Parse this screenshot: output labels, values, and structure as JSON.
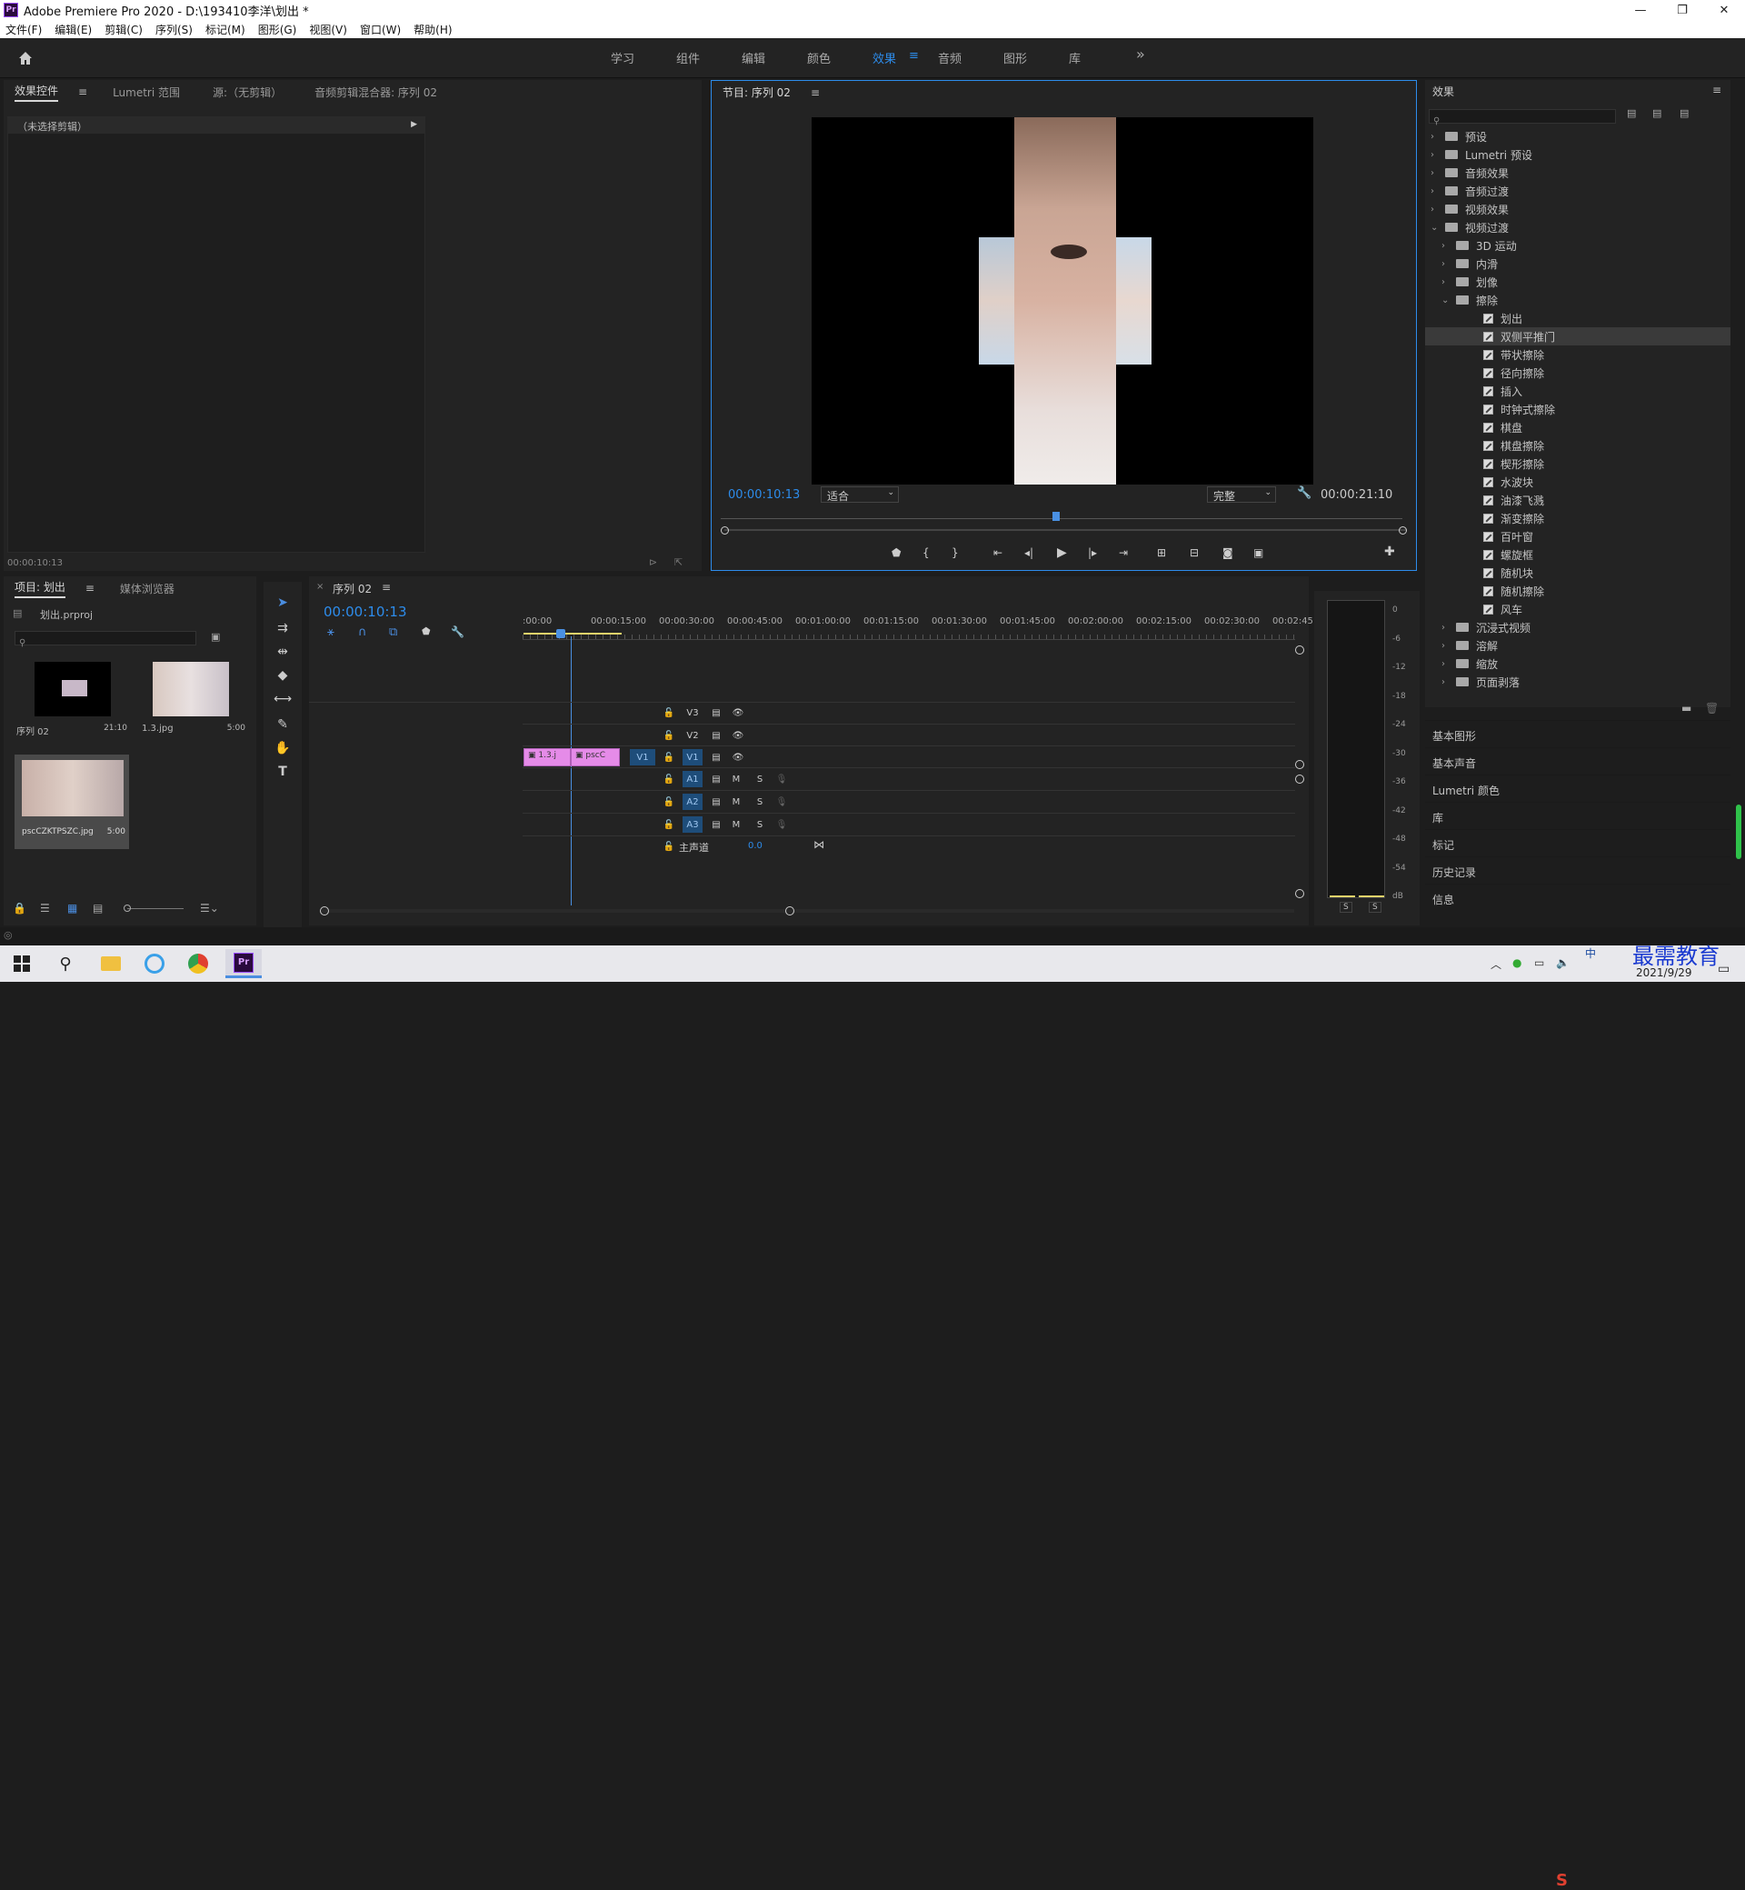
{
  "app": {
    "title": "Adobe Premiere Pro 2020 - D:\\193410李洋\\划出 *",
    "logo": "Pr"
  },
  "window_controls": {
    "minimize": "—",
    "maximize": "❐",
    "close": "✕"
  },
  "menu": [
    "文件(F)",
    "编辑(E)",
    "剪辑(C)",
    "序列(S)",
    "标记(M)",
    "图形(G)",
    "视图(V)",
    "窗口(W)",
    "帮助(H)"
  ],
  "workspaces": [
    {
      "label": "学习",
      "active": false
    },
    {
      "label": "组件",
      "active": false
    },
    {
      "label": "编辑",
      "active": false
    },
    {
      "label": "颜色",
      "active": false
    },
    {
      "label": "效果",
      "active": true
    },
    {
      "label": "音频",
      "active": false
    },
    {
      "label": "图形",
      "active": false
    },
    {
      "label": "库",
      "active": false
    }
  ],
  "workspace_more": "»",
  "source_panel": {
    "tabs": [
      "效果控件",
      "Lumetri 范围",
      "源:（无剪辑）",
      "音频剪辑混合器: 序列 02"
    ],
    "no_clip": "（未选择剪辑）",
    "timecode": "00:00:10:13"
  },
  "program": {
    "tab": "节目: 序列 02",
    "timecode": "00:00:10:13",
    "fit": "适合",
    "quality": "完整",
    "duration": "00:00:21:10"
  },
  "project": {
    "tabs": [
      "项目: 划出",
      "媒体浏览器"
    ],
    "file": "划出.prproj",
    "items": [
      {
        "name": "序列 02",
        "duration": "21:10"
      },
      {
        "name": "1.3.jpg",
        "duration": "5:00"
      },
      {
        "name": "pscCZKTPSZC.jpg",
        "duration": "5:00"
      }
    ]
  },
  "timeline": {
    "tab": "序列 02",
    "timecode": "00:00:10:13",
    "ruler": [
      ":00:00",
      "00:00:15:00",
      "00:00:30:00",
      "00:00:45:00",
      "00:01:00:00",
      "00:01:15:00",
      "00:01:30:00",
      "00:01:45:00",
      "00:02:00:00",
      "00:02:15:00",
      "00:02:30:00",
      "00:02:45:"
    ],
    "tracks": {
      "video": [
        "V3",
        "V2",
        "V1"
      ],
      "audio": [
        "A1",
        "A2",
        "A3"
      ],
      "master_label": "主声道",
      "master_value": "0.0",
      "src_patch": "V1",
      "toggles": {
        "m": "M",
        "s": "S"
      }
    },
    "clips": [
      {
        "label": "1.3.j"
      },
      {
        "label": "pscC"
      }
    ]
  },
  "audio_meter": {
    "scale": [
      "0",
      "-6",
      "-12",
      "-18",
      "-24",
      "-30",
      "-36",
      "-42",
      "-48",
      "-54",
      "dB"
    ],
    "solo": [
      "S",
      "S"
    ]
  },
  "effects": {
    "title": "效果",
    "tree": [
      {
        "label": "预设",
        "level": 0,
        "type": "folder",
        "open": false
      },
      {
        "label": "Lumetri 预设",
        "level": 0,
        "type": "folder",
        "open": false
      },
      {
        "label": "音频效果",
        "level": 0,
        "type": "folder",
        "open": false
      },
      {
        "label": "音频过渡",
        "level": 0,
        "type": "folder",
        "open": false
      },
      {
        "label": "视频效果",
        "level": 0,
        "type": "folder",
        "open": false
      },
      {
        "label": "视频过渡",
        "level": 0,
        "type": "folder",
        "open": true
      },
      {
        "label": "3D 运动",
        "level": 1,
        "type": "folder",
        "open": false
      },
      {
        "label": "内滑",
        "level": 1,
        "type": "folder",
        "open": false
      },
      {
        "label": "划像",
        "level": 1,
        "type": "folder",
        "open": false
      },
      {
        "label": "擦除",
        "level": 1,
        "type": "folder",
        "open": true
      },
      {
        "label": "划出",
        "level": 2,
        "type": "fx"
      },
      {
        "label": "双侧平推门",
        "level": 2,
        "type": "fx",
        "selected": true
      },
      {
        "label": "带状擦除",
        "level": 2,
        "type": "fx"
      },
      {
        "label": "径向擦除",
        "level": 2,
        "type": "fx"
      },
      {
        "label": "插入",
        "level": 2,
        "type": "fx"
      },
      {
        "label": "时钟式擦除",
        "level": 2,
        "type": "fx"
      },
      {
        "label": "棋盘",
        "level": 2,
        "type": "fx"
      },
      {
        "label": "棋盘擦除",
        "level": 2,
        "type": "fx"
      },
      {
        "label": "楔形擦除",
        "level": 2,
        "type": "fx"
      },
      {
        "label": "水波块",
        "level": 2,
        "type": "fx"
      },
      {
        "label": "油漆飞溅",
        "level": 2,
        "type": "fx"
      },
      {
        "label": "渐变擦除",
        "level": 2,
        "type": "fx"
      },
      {
        "label": "百叶窗",
        "level": 2,
        "type": "fx"
      },
      {
        "label": "螺旋框",
        "level": 2,
        "type": "fx"
      },
      {
        "label": "随机块",
        "level": 2,
        "type": "fx"
      },
      {
        "label": "随机擦除",
        "level": 2,
        "type": "fx"
      },
      {
        "label": "风车",
        "level": 2,
        "type": "fx"
      },
      {
        "label": "沉浸式视频",
        "level": 1,
        "type": "folder",
        "open": false
      },
      {
        "label": "溶解",
        "level": 1,
        "type": "folder",
        "open": false
      },
      {
        "label": "缩放",
        "level": 1,
        "type": "folder",
        "open": false
      },
      {
        "label": "页面剥落",
        "level": 1,
        "type": "folder",
        "open": false
      }
    ],
    "collapsed_panels": [
      "基本图形",
      "基本声音",
      "Lumetri 颜色",
      "库",
      "标记",
      "历史记录",
      "信息"
    ]
  },
  "taskbar": {
    "date": "2021/9/29",
    "watermark": "最需教育",
    "ime": "中"
  },
  "colors": {
    "accent": "#2d8ceb",
    "clip": "#e58be8",
    "playhead": "#4a90e2",
    "selection": "#3a3a3a"
  }
}
